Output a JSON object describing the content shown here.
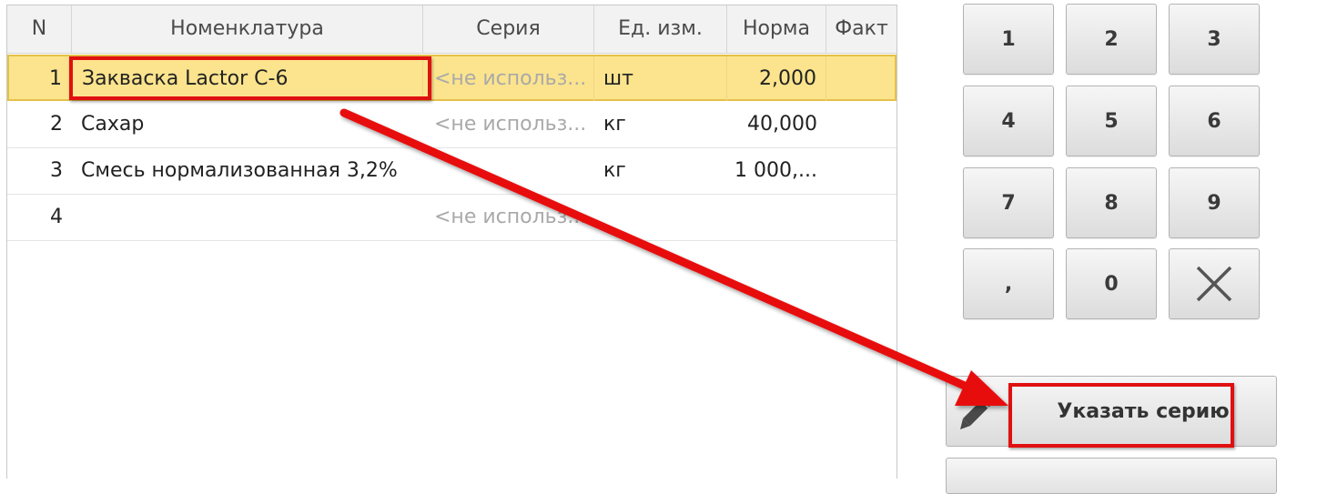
{
  "table": {
    "columns": [
      "N",
      "Номенклатура",
      "Серия",
      "Ед. изм.",
      "Норма",
      "Факт"
    ],
    "rows": [
      {
        "n": "1",
        "item": "Закваска Lactor C-6",
        "series": "<не использ...",
        "unit": "шт",
        "norm": "2,000",
        "fact": ""
      },
      {
        "n": "2",
        "item": "Сахар",
        "series": "<не использ...",
        "unit": "кг",
        "norm": "40,000",
        "fact": ""
      },
      {
        "n": "3",
        "item": "Смесь нормализованная 3,2%",
        "series": "",
        "unit": "кг",
        "norm": "1 000,...",
        "fact": ""
      },
      {
        "n": "4",
        "item": "",
        "series": "<не использ...",
        "unit": "",
        "norm": "",
        "fact": ""
      }
    ],
    "selected_row": 1
  },
  "keypad": {
    "keys": [
      "1",
      "2",
      "3",
      "4",
      "5",
      "6",
      "7",
      "8",
      "9",
      ",",
      "0"
    ],
    "clear_icon": "close-icon"
  },
  "actions": {
    "set_series_label": "Указать серию",
    "set_series_icon": "pencil-icon"
  },
  "annotations": {
    "highlight_color": "#e01010",
    "selected_row_color": "#fbe48d"
  }
}
